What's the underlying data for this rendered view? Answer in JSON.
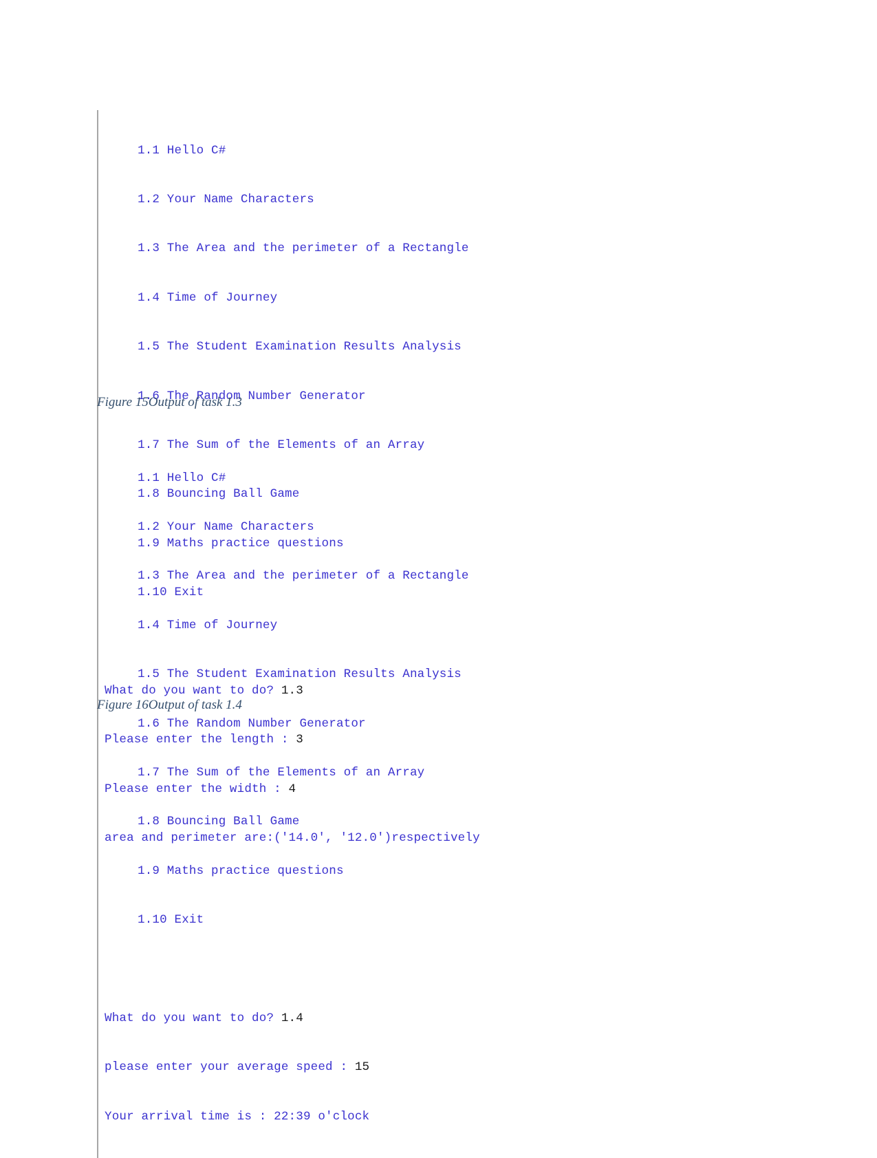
{
  "document": {
    "page_background": "#ffffff",
    "console_text_color": "#3b32cf",
    "user_input_color": "#1a1a1a",
    "caption_color": "#36506e",
    "console_rule_color": "#a6a6a6"
  },
  "figures": [
    {
      "id": "figure-15",
      "caption": "Figure 15Output of task 1.3",
      "console": {
        "menu": [
          "1.1 Hello C#",
          "1.2 Your Name Characters",
          "1.3 The Area and the perimeter of a Rectangle",
          "1.4 Time of Journey",
          "1.5 The Student Examination Results Analysis",
          "1.6 The Random Number Generator",
          "1.7 The Sum of the Elements of an Array",
          "1.8 Bouncing Ball Game",
          "1.9 Maths practice questions",
          "1.10 Exit"
        ],
        "session": [
          {
            "prompt": "What do you want to do? ",
            "input": "1.3"
          },
          {
            "prompt": "Please enter the length : ",
            "input": "3"
          },
          {
            "prompt": "Please enter the width : ",
            "input": "4"
          },
          {
            "prompt": "area and perimeter are:('14.0', '12.0')respectively",
            "input": ""
          }
        ]
      }
    },
    {
      "id": "figure-16",
      "caption": "Figure 16Output of task 1.4",
      "console": {
        "menu": [
          "1.1 Hello C#",
          "1.2 Your Name Characters",
          "1.3 The Area and the perimeter of a Rectangle",
          "1.4 Time of Journey",
          "1.5 The Student Examination Results Analysis",
          "1.6 The Random Number Generator",
          "1.7 The Sum of the Elements of an Array",
          "1.8 Bouncing Ball Game",
          "1.9 Maths practice questions",
          "1.10 Exit"
        ],
        "session": [
          {
            "prompt": "What do you want to do? ",
            "input": "1.4"
          },
          {
            "prompt": "please enter your average speed : ",
            "input": "15"
          },
          {
            "prompt": "Your arrival time is : 22:39 o'clock",
            "input": ""
          }
        ]
      }
    }
  ]
}
